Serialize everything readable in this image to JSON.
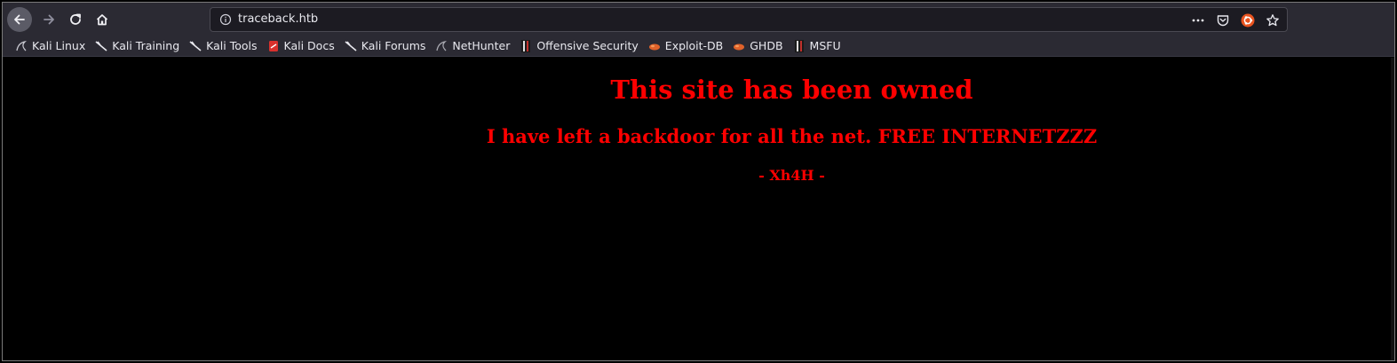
{
  "browser": {
    "url": "traceback.htb",
    "icons": {
      "back": "arrow-left-icon",
      "forward": "arrow-right-icon",
      "reload": "reload-icon",
      "home": "home-icon",
      "info": "info-icon",
      "more": "more-icon",
      "pocket": "pocket-icon",
      "ubuntu": "ubuntu-icon",
      "star": "star-icon"
    }
  },
  "bookmarks": [
    {
      "label": "Kali Linux",
      "icon": "kali-dragon-icon"
    },
    {
      "label": "Kali Training",
      "icon": "kali-icon"
    },
    {
      "label": "Kali Tools",
      "icon": "kali-icon"
    },
    {
      "label": "Kali Docs",
      "icon": "kali-docs-icon"
    },
    {
      "label": "Kali Forums",
      "icon": "kali-icon"
    },
    {
      "label": "NetHunter",
      "icon": "kali-dragon-icon"
    },
    {
      "label": "Offensive Security",
      "icon": "offsec-icon"
    },
    {
      "label": "Exploit-DB",
      "icon": "exploitdb-icon"
    },
    {
      "label": "GHDB",
      "icon": "exploitdb-icon"
    },
    {
      "label": "MSFU",
      "icon": "offsec-icon"
    }
  ],
  "page": {
    "heading": "This site has been owned",
    "subheading": "I have left a backdoor for all the net. FREE INTERNETZZZ",
    "signature": "- Xh4H -",
    "text_color": "#ff0000",
    "background_color": "#000000"
  }
}
